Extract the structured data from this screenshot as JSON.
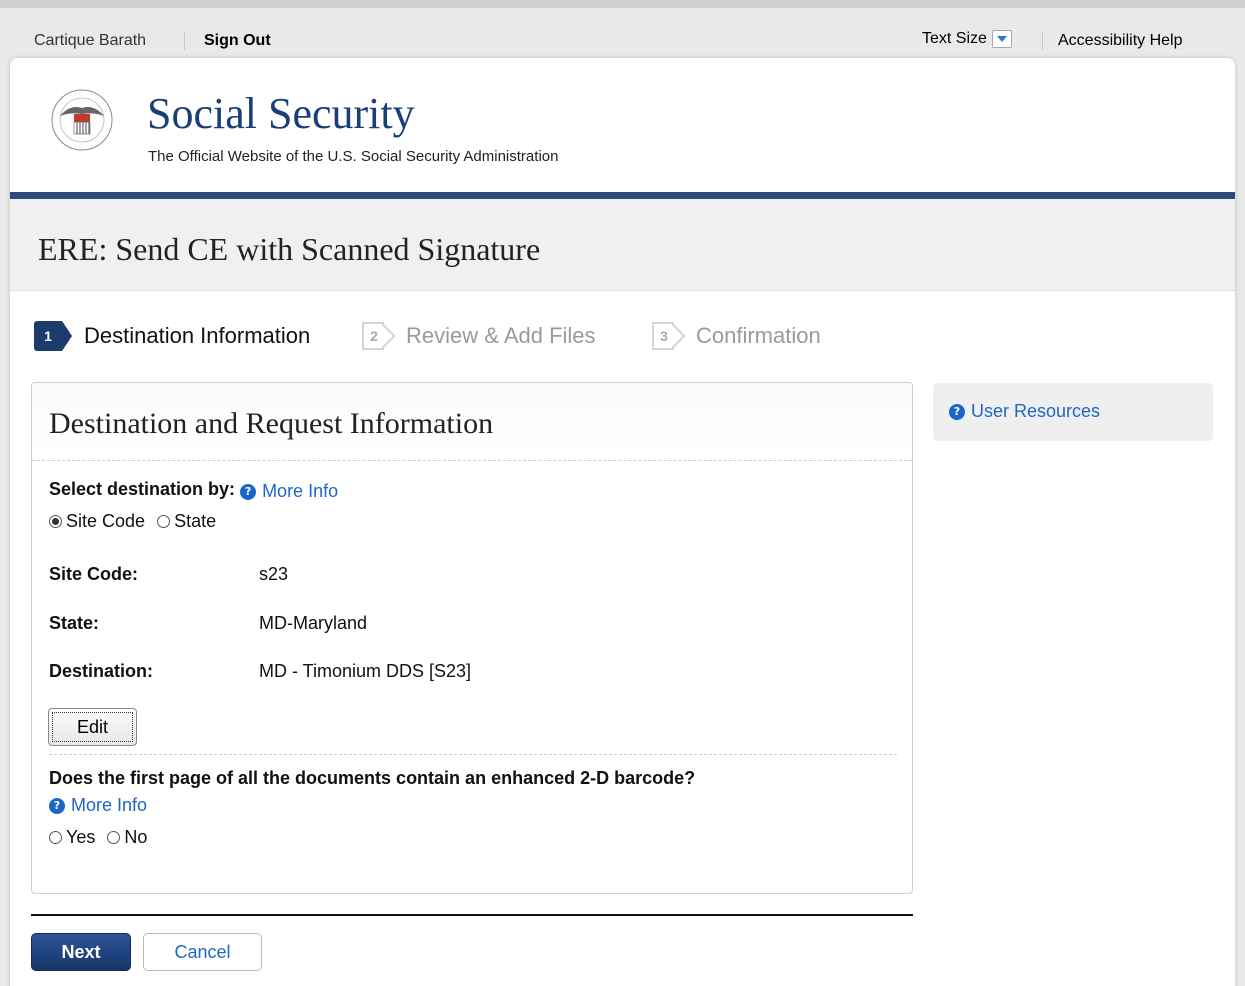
{
  "utility": {
    "user_name": "Cartique Barath",
    "sign_out": "Sign Out",
    "text_size": "Text Size",
    "accessibility_help": "Accessibility Help"
  },
  "masthead": {
    "title": "Social Security",
    "subtitle": "The Official Website of the U.S. Social Security Administration"
  },
  "page_title": "ERE: Send CE with Scanned Signature",
  "steps": [
    {
      "number": "1",
      "label": "Destination Information",
      "state": "active"
    },
    {
      "number": "2",
      "label": "Review & Add Files",
      "state": "inactive"
    },
    {
      "number": "3",
      "label": "Confirmation",
      "state": "inactive"
    }
  ],
  "panel": {
    "heading": "Destination and Request Information",
    "select_by_label": "Select destination by:",
    "more_info": "More Info",
    "select_by_options": [
      {
        "label": "Site Code",
        "selected": true
      },
      {
        "label": "State",
        "selected": false
      }
    ],
    "fields": [
      {
        "label": "Site Code:",
        "value": "s23"
      },
      {
        "label": "State:",
        "value": "MD-Maryland"
      },
      {
        "label": "Destination:",
        "value": "MD - Timonium DDS [S23]"
      }
    ],
    "edit_button": "Edit",
    "barcode_question": "Does the first page of all the documents contain an enhanced 2-D barcode?",
    "barcode_more_info": "More Info",
    "barcode_options": [
      {
        "label": "Yes",
        "selected": false
      },
      {
        "label": "No",
        "selected": false
      }
    ]
  },
  "actions": {
    "next": "Next",
    "cancel": "Cancel"
  },
  "sidebar": {
    "user_resources": "User Resources"
  },
  "colors": {
    "brand_navy": "#1b3b6c",
    "link_blue": "#1d67c5",
    "masthead_rule": "#2f4a78"
  }
}
